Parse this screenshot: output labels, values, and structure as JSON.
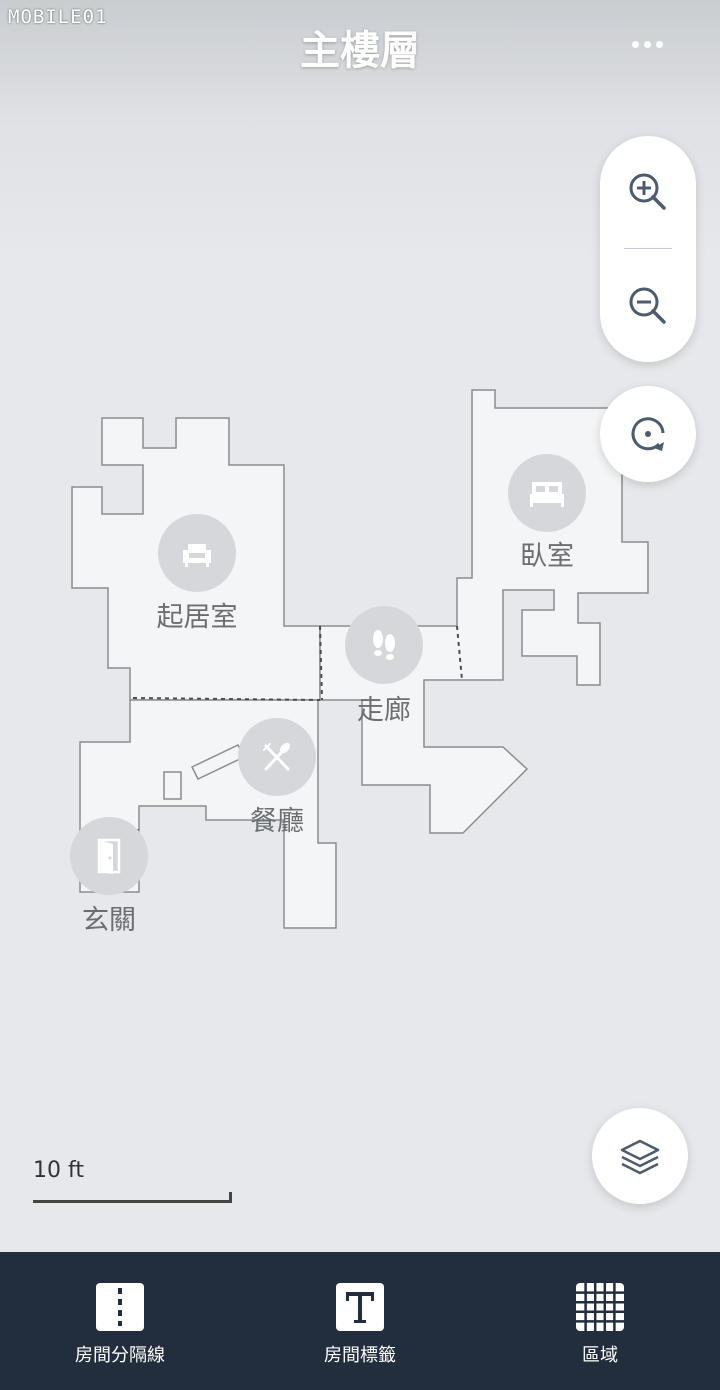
{
  "watermark": "MOBILE01",
  "header": {
    "title": "主樓層"
  },
  "rooms": {
    "living": "起居室",
    "bedroom": "臥室",
    "hallway": "走廊",
    "dining": "餐廳",
    "entrance": "玄關"
  },
  "scale": {
    "label": "10 ft"
  },
  "toolbar": {
    "divider_label": "房間分隔線",
    "tag_label": "房間標籤",
    "zone_label": "區域"
  },
  "colors": {
    "background": "#e6e8eb",
    "floor": "#f4f5f6",
    "toolbar_bg": "#222d3e",
    "icon_slate": "#4d5b6e"
  }
}
